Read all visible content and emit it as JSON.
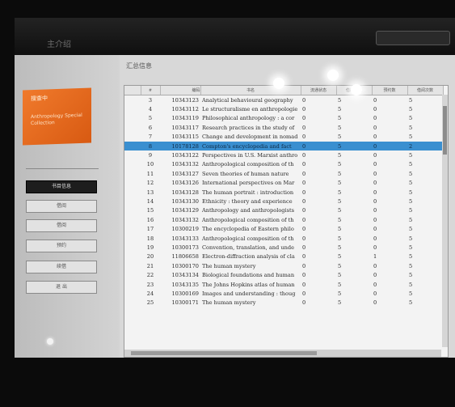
{
  "window": {
    "title": "主介绍"
  },
  "sidebar": {
    "card_title": "搜查中",
    "card_subtitle": "Anthropology Special Collection",
    "buttons": [
      "书目信息",
      "借阅",
      "借阅",
      "预约",
      "续借",
      "退 出"
    ]
  },
  "main": {
    "heading": "汇总信息"
  },
  "table": {
    "columns": [
      "#",
      "编码",
      "书名",
      "流通状态",
      "借出天数",
      "预约数",
      "借阅次数"
    ],
    "rows": [
      {
        "idx": "",
        "num": "3",
        "code": "10343123",
        "title": "Analytical behavioural geography",
        "c1": "0",
        "c2": "5",
        "c3": "0",
        "c4": "5"
      },
      {
        "idx": "",
        "num": "4",
        "code": "10343112",
        "title": "Le structuralisme en anthropologie",
        "c1": "0",
        "c2": "5",
        "c3": "0",
        "c4": "5"
      },
      {
        "idx": "",
        "num": "5",
        "code": "10343119",
        "title": "Philosophical anthropology : a cor",
        "c1": "0",
        "c2": "5",
        "c3": "0",
        "c4": "5"
      },
      {
        "idx": "",
        "num": "6",
        "code": "10343117",
        "title": "Research practices in the study of",
        "c1": "0",
        "c2": "5",
        "c3": "0",
        "c4": "5"
      },
      {
        "idx": "",
        "num": "7",
        "code": "10343115",
        "title": "Change and development in nomad",
        "c1": "0",
        "c2": "5",
        "c3": "0",
        "c4": "5"
      },
      {
        "idx": "",
        "num": "8",
        "code": "10178128",
        "title": "Compton's encyclopedia and fact",
        "c1": "0",
        "c2": "5",
        "c3": "0",
        "c4": "2",
        "selected": true
      },
      {
        "idx": "",
        "num": "9",
        "code": "10343122",
        "title": "Perspectives in U.S. Marxist anthro",
        "c1": "0",
        "c2": "5",
        "c3": "0",
        "c4": "5"
      },
      {
        "idx": "",
        "num": "10",
        "code": "10343132",
        "title": "Anthropological composition of th",
        "c1": "0",
        "c2": "5",
        "c3": "0",
        "c4": "5"
      },
      {
        "idx": "",
        "num": "11",
        "code": "10343127",
        "title": "Seven theories of human nature",
        "c1": "0",
        "c2": "5",
        "c3": "0",
        "c4": "5"
      },
      {
        "idx": "",
        "num": "12",
        "code": "10343126",
        "title": "International perspectives on Mar",
        "c1": "0",
        "c2": "5",
        "c3": "0",
        "c4": "5"
      },
      {
        "idx": "",
        "num": "13",
        "code": "10343128",
        "title": "The human portrait : introduction",
        "c1": "0",
        "c2": "5",
        "c3": "0",
        "c4": "5"
      },
      {
        "idx": "",
        "num": "14",
        "code": "10343130",
        "title": "Ethnicity : theory and experience",
        "c1": "0",
        "c2": "5",
        "c3": "0",
        "c4": "5"
      },
      {
        "idx": "",
        "num": "15",
        "code": "10343129",
        "title": "Anthropology and anthropologists",
        "c1": "0",
        "c2": "5",
        "c3": "0",
        "c4": "5"
      },
      {
        "idx": "",
        "num": "16",
        "code": "10343132",
        "title": "Anthropological composition of th",
        "c1": "0",
        "c2": "5",
        "c3": "0",
        "c4": "5"
      },
      {
        "idx": "",
        "num": "17",
        "code": "10300219",
        "title": "The encyclopedia of Eastern philo",
        "c1": "0",
        "c2": "5",
        "c3": "0",
        "c4": "5"
      },
      {
        "idx": "",
        "num": "18",
        "code": "10343133",
        "title": "Anthropological composition of th",
        "c1": "0",
        "c2": "5",
        "c3": "0",
        "c4": "5"
      },
      {
        "idx": "",
        "num": "19",
        "code": "10300173",
        "title": "Convention, translation, and unde",
        "c1": "0",
        "c2": "5",
        "c3": "0",
        "c4": "5"
      },
      {
        "idx": "",
        "num": "20",
        "code": "11806658",
        "title": "Electron-diffraction analysis of cla",
        "c1": "0",
        "c2": "5",
        "c3": "1",
        "c4": "5"
      },
      {
        "idx": "",
        "num": "21",
        "code": "10300170",
        "title": "The human mystery",
        "c1": "0",
        "c2": "5",
        "c3": "0",
        "c4": "5"
      },
      {
        "idx": "",
        "num": "22",
        "code": "10343134",
        "title": "Biological foundations and human",
        "c1": "0",
        "c2": "5",
        "c3": "0",
        "c4": "5"
      },
      {
        "idx": "",
        "num": "23",
        "code": "10343135",
        "title": "The Johns Hopkins atlas of human",
        "c1": "0",
        "c2": "5",
        "c3": "0",
        "c4": "5"
      },
      {
        "idx": "",
        "num": "24",
        "code": "10300169",
        "title": "Images and understanding : thoug",
        "c1": "0",
        "c2": "5",
        "c3": "0",
        "c4": "5"
      },
      {
        "idx": "",
        "num": "25",
        "code": "10300171",
        "title": "The human mystery",
        "c1": "0",
        "c2": "5",
        "c3": "0",
        "c4": "5"
      }
    ]
  }
}
